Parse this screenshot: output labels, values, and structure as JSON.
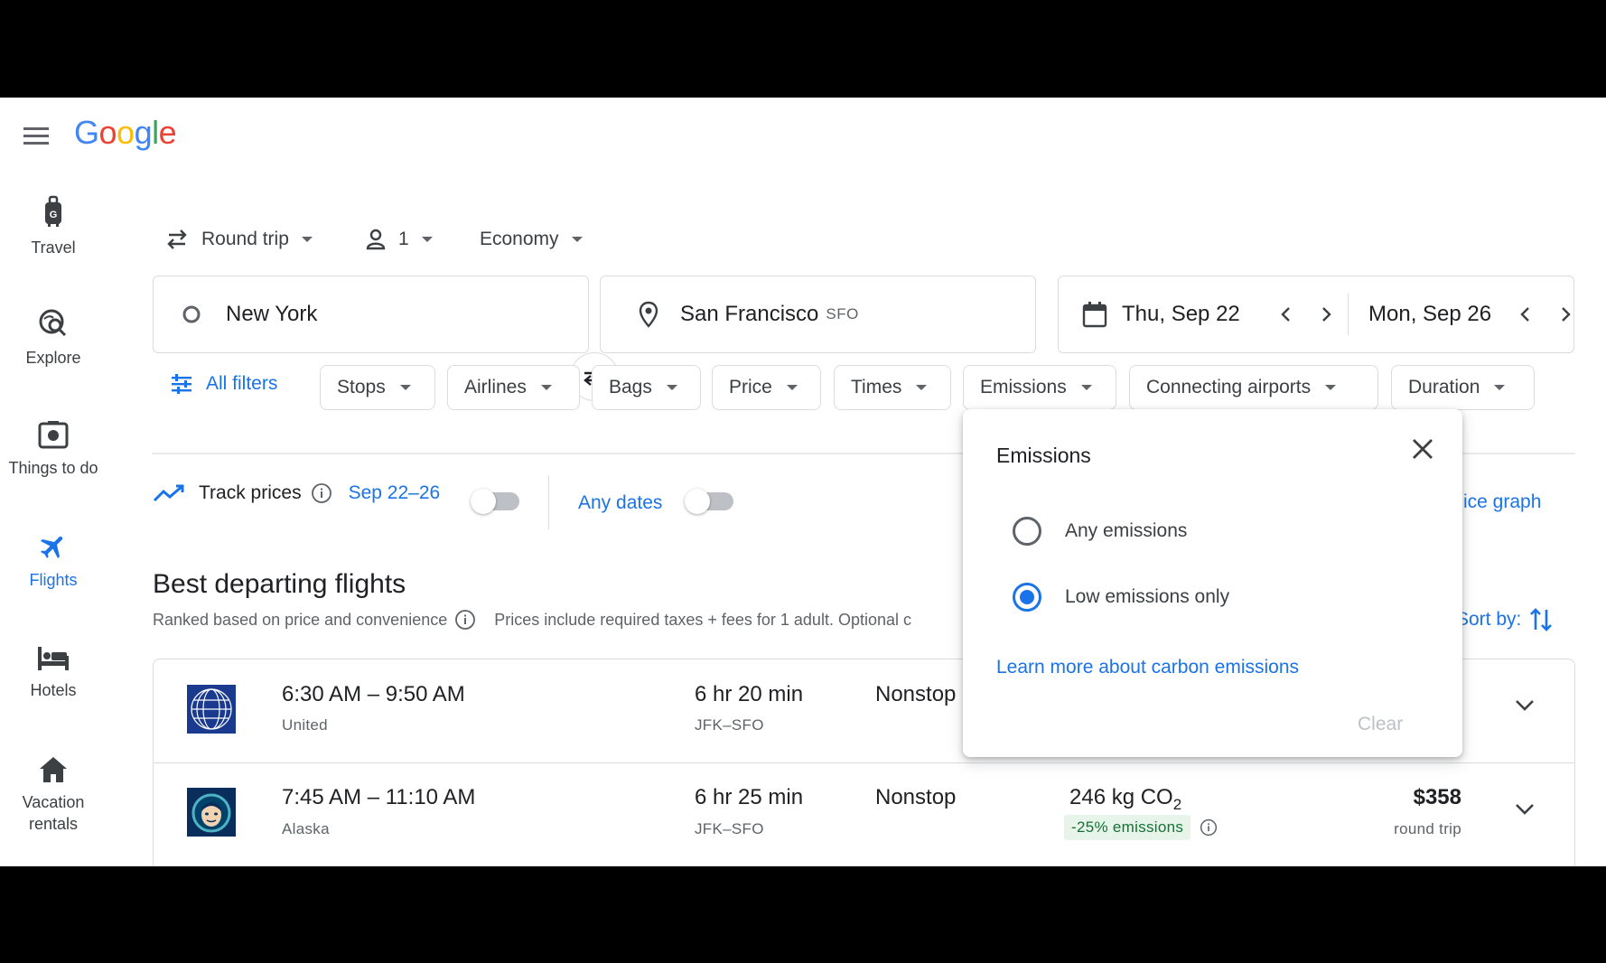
{
  "header": {
    "logo_letters": [
      "G",
      "o",
      "o",
      "g",
      "l",
      "e"
    ]
  },
  "nav": [
    {
      "label": "Travel",
      "icon": "luggage-icon"
    },
    {
      "label": "Explore",
      "icon": "explore-icon"
    },
    {
      "label": "Things to do",
      "icon": "camera-icon"
    },
    {
      "label": "Flights",
      "icon": "flight-icon"
    },
    {
      "label": "Hotels",
      "icon": "hotel-icon"
    },
    {
      "label": "Vacation rentals",
      "icon": "house-icon"
    }
  ],
  "trip_options": {
    "trip_type": "Round trip",
    "passengers": "1",
    "cabin": "Economy"
  },
  "search": {
    "origin": "New York",
    "destination": "San Francisco",
    "destination_code": "SFO",
    "depart_date": "Thu, Sep 22",
    "return_date": "Mon, Sep 26"
  },
  "filters": {
    "all_filters": "All filters",
    "chips": [
      "Stops",
      "Airlines",
      "Bags",
      "Price",
      "Times",
      "Emissions",
      "Connecting airports",
      "Duration"
    ]
  },
  "track": {
    "label": "Track prices",
    "dates": "Sep 22–26",
    "any_dates": "Any dates",
    "price_graph_partial": "ice graph"
  },
  "results": {
    "title": "Best departing flights",
    "ranked": "Ranked based on price and convenience",
    "prices_note": "Prices include required taxes + fees for 1 adult. Optional c",
    "sort_label": "Sort by:"
  },
  "flights": [
    {
      "times": "6:30 AM – 9:50 AM",
      "airline": "United",
      "duration": "6 hr 20 min",
      "route": "JFK–SFO",
      "stops": "Nonstop"
    },
    {
      "times": "7:45 AM – 11:10 AM",
      "airline": "Alaska",
      "duration": "6 hr 25 min",
      "route": "JFK–SFO",
      "stops": "Nonstop",
      "emissions_value": "246 kg CO",
      "emissions_sub": "2",
      "emissions_badge": "-25% emissions",
      "price": "$358",
      "price_note": "round trip"
    }
  ],
  "emissions_popup": {
    "title": "Emissions",
    "options": [
      {
        "label": "Any emissions",
        "selected": false
      },
      {
        "label": "Low emissions only",
        "selected": true
      }
    ],
    "learn_more": "Learn more about carbon emissions",
    "clear": "Clear"
  },
  "colors": {
    "accent": "#1a73e8",
    "badge_bg": "#e6f4ea",
    "badge_text": "#137333"
  }
}
